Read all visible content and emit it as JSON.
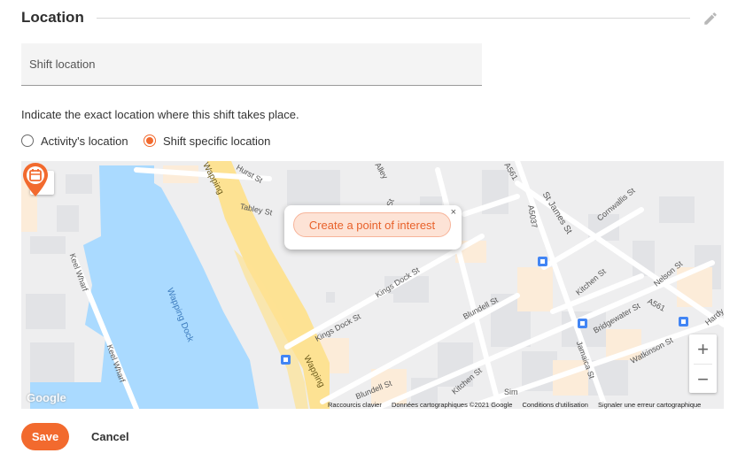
{
  "section": {
    "title": "Location"
  },
  "location_field": {
    "placeholder": "Shift location",
    "value": ""
  },
  "helper_text": "Indicate the exact location where this shift takes place.",
  "radio_options": [
    {
      "label": "Activity's location",
      "checked": false
    },
    {
      "label": "Shift specific location",
      "checked": true
    }
  ],
  "map": {
    "popup_button": "Create a point of interest",
    "popup_close": "×",
    "zoom_in": "+",
    "zoom_out": "−",
    "logo": "Google",
    "attribution": {
      "shortcuts": "Raccourcis clavier",
      "data": "Données cartographiques ©2021 Google",
      "terms": "Conditions d'utilisation",
      "report": "Signaler une erreur cartographique"
    },
    "labels": {
      "wapping_top": "Wapping",
      "wapping_bottom": "Wapping",
      "wapping_dock": "Wapping Dock",
      "keel_wharf_1": "Keel Wharf",
      "keel_wharf_2": "Keel Wharf",
      "kings_dock_1": "Kings Dock St",
      "kings_dock_2": "Kings Dock St",
      "kings_dock_3": "Kings Dock St",
      "blundell_1": "Blundell St",
      "blundell_2": "Blundell St",
      "st_james": "St James St",
      "a5037": "A5037",
      "a561_1": "A561",
      "a561_2": "A561",
      "cornwallis": "Cornwallis St",
      "nelson": "Nelson St",
      "kitchen_1": "Kitchen St",
      "kitchen_2": "Kitchen St",
      "bridgewater": "Bridgewater St",
      "jamaica": "Jamaica St",
      "watkinson": "Watkinson St",
      "tabley": "Tabley St",
      "hurst": "Hurst St",
      "alley": "Alley",
      "hardy": "Hardy",
      "kings_st": "s St",
      "sim": "Sim"
    }
  },
  "actions": {
    "save": "Save",
    "cancel": "Cancel"
  },
  "colors": {
    "accent": "#f26a2e",
    "water": "#aadaff",
    "major_road": "#fde293"
  }
}
